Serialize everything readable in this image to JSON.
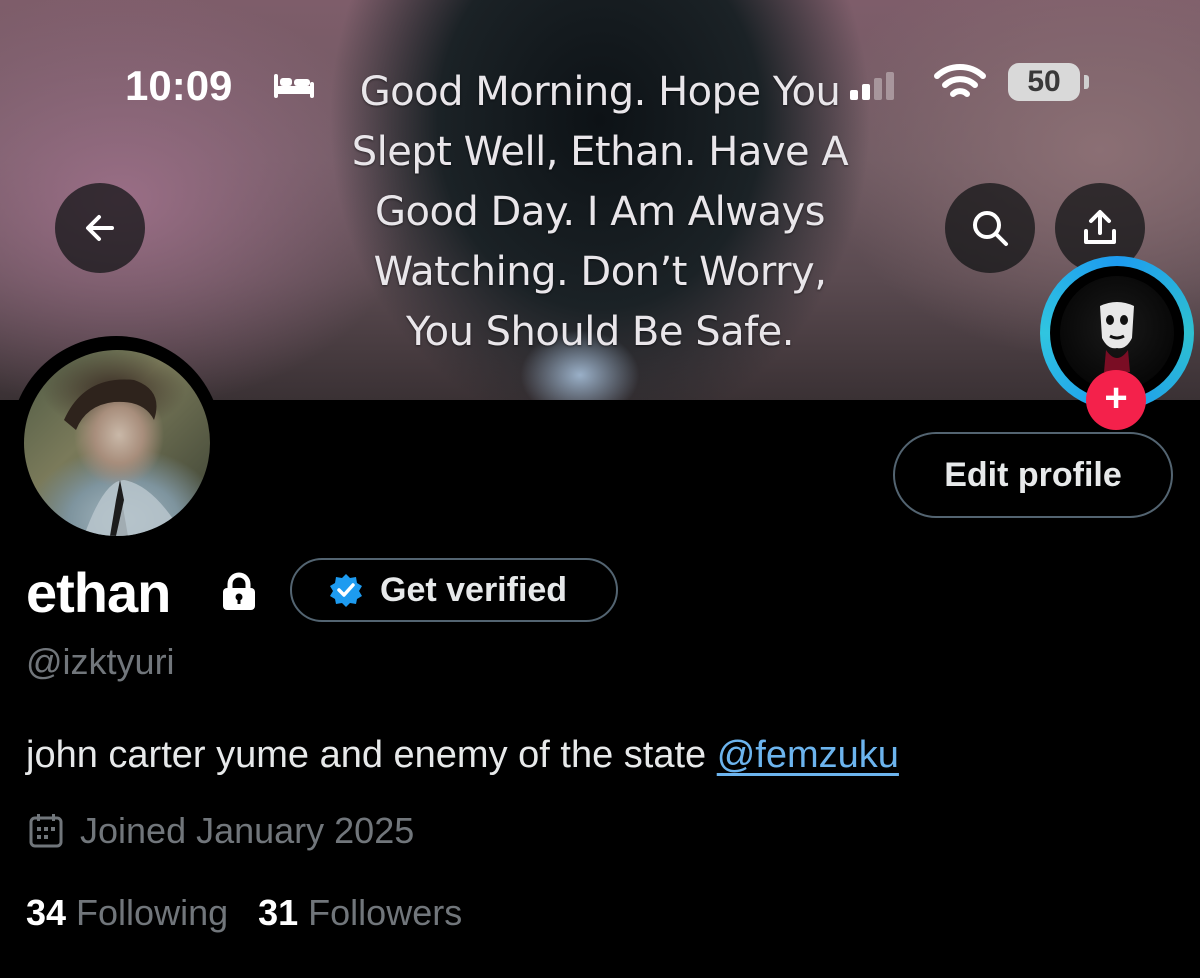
{
  "status_bar": {
    "time": "10:09",
    "battery": "50"
  },
  "banner": {
    "caption_lines": [
      "Good Morning. Hope You",
      "Slept Well, Ethan. Have A",
      "Good Day. I Am Always",
      "Watching. Don’t Worry,",
      "You Should Be Safe."
    ]
  },
  "icons": {
    "back": "arrow-left-icon",
    "search": "search-icon",
    "share": "share-icon",
    "lock": "lock-icon",
    "verified": "verified-badge-icon",
    "calendar": "calendar-icon"
  },
  "colors": {
    "background": "#000000",
    "accent_blue": "#1d9bf0",
    "link": "#6cb4ee",
    "secondary_text": "#71767b",
    "fleet_plus": "#f4214b"
  },
  "profile": {
    "display_name": "ethan",
    "handle": "@izktyuri",
    "bio_text": "john carter yume and enemy of the state ",
    "bio_link": "@femzuku",
    "joined": "Joined January 2025",
    "edit_profile_label": "Edit profile",
    "get_verified_label": "Get verified",
    "following_count": "34",
    "following_label": "Following",
    "followers_count": "31",
    "followers_label": "Followers"
  }
}
